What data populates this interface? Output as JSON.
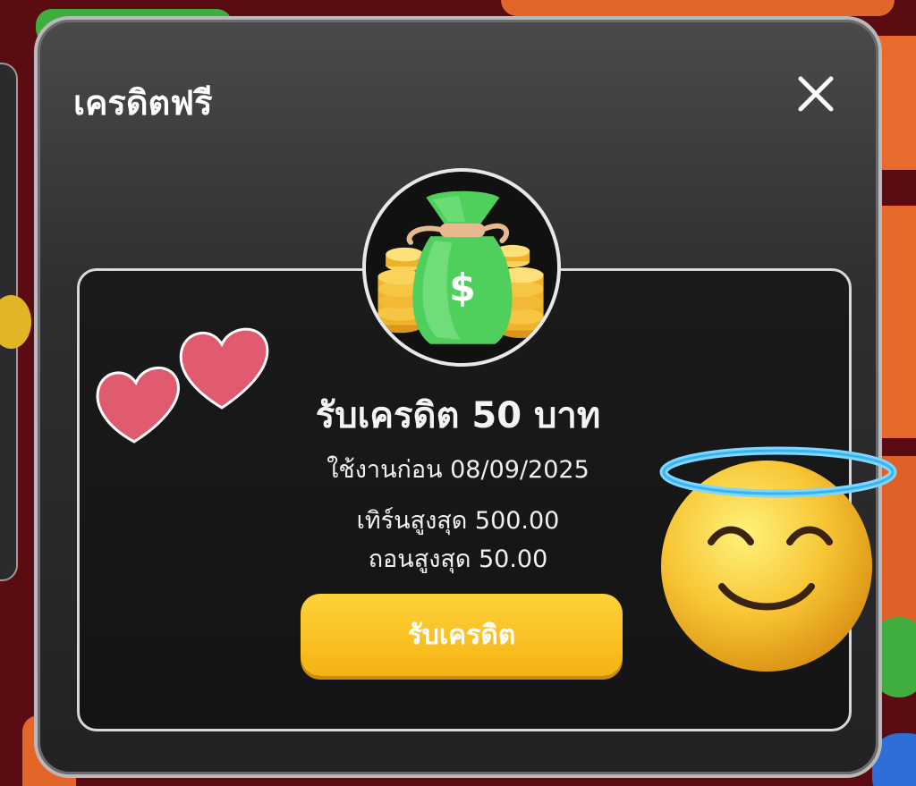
{
  "modal": {
    "title": "เครดิตฟรี",
    "close_icon": "close-icon"
  },
  "reward": {
    "icon": "money-bag-icon",
    "title": "รับเครดิต 50 บาท",
    "expire_text": "ใช้งานก่อน 08/09/2025",
    "max_turnover_text": "เทิร์นสูงสุด 500.00",
    "max_withdraw_text": "ถอนสูงสุด 50.00"
  },
  "claim_button": {
    "label": "รับเครดิต"
  },
  "stickers": {
    "hearts": "hearts-sticker",
    "face": "smiling-face-with-halo-emoji"
  },
  "colors": {
    "accent": "#f5b313",
    "modal_bg": "#2f2f31",
    "card_border": "#d8d8d8"
  }
}
